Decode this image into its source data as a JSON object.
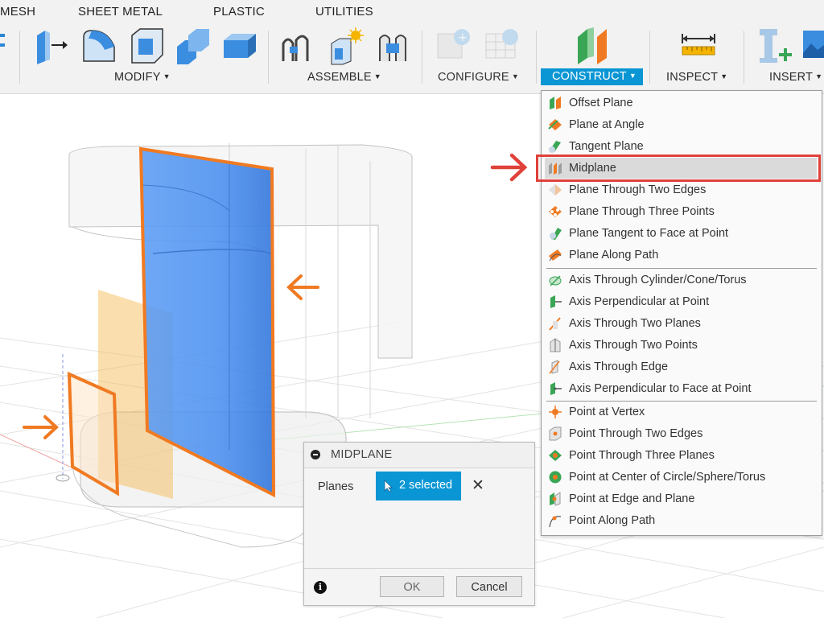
{
  "tabs": [
    "MESH",
    "SHEET METAL",
    "PLASTIC",
    "UTILITIES"
  ],
  "toolbar_groups": {
    "modify": "MODIFY",
    "assemble": "ASSEMBLE",
    "configure": "CONFIGURE",
    "construct": "CONSTRUCT",
    "inspect": "INSPECT",
    "insert": "INSERT"
  },
  "menu_items": [
    "Offset Plane",
    "Plane at Angle",
    "Tangent Plane",
    "Midplane",
    "Plane Through Two Edges",
    "Plane Through Three Points",
    "Plane Tangent to Face at Point",
    "Plane Along Path",
    "Axis Through Cylinder/Cone/Torus",
    "Axis Perpendicular at Point",
    "Axis Through Two Planes",
    "Axis Through Two Points",
    "Axis Through Edge",
    "Axis Perpendicular to Face at Point",
    "Point at Vertex",
    "Point Through Two Edges",
    "Point Through Three Planes",
    "Point at Center of Circle/Sphere/Torus",
    "Point at Edge and Plane",
    "Point Along Path"
  ],
  "highlighted_menu_item": "Midplane",
  "dialog": {
    "title": "MIDPLANE",
    "planes_label": "Planes",
    "selection": "2 selected",
    "clear": "✕",
    "info": "i",
    "ok": "OK",
    "cancel": "Cancel"
  },
  "colors": {
    "accent_blue": "#0a96d4",
    "annotation_red": "#e0413a",
    "annotation_orange": "#f07a22",
    "plane_blue": "#4a8ff0"
  }
}
